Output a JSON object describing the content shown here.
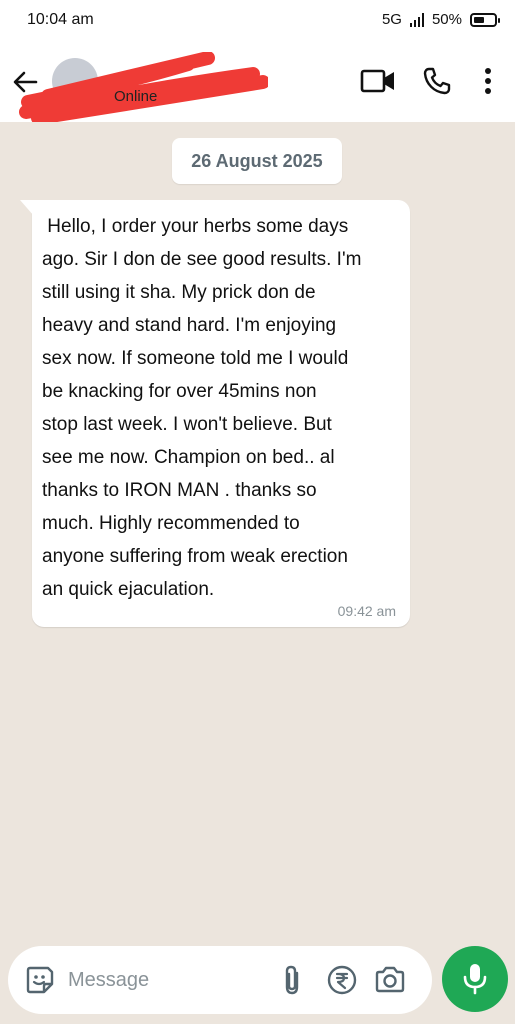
{
  "status_bar": {
    "time": "10:04 am",
    "network": "5G",
    "battery": "50%",
    "battery_level": 0.5
  },
  "header": {
    "contact_name": "",
    "contact_status": "Online",
    "icons": [
      "back-arrow-icon",
      "video-call-icon",
      "phone-icon",
      "more-vertical-icon"
    ]
  },
  "chat": {
    "date_label": "26 August 2025",
    "messages": [
      {
        "direction": "incoming",
        "lines": [
          " Hello, I order your herbs some days",
          "ago. Sir I don de see good results. I'm",
          "still using it sha. My prick don de",
          "heavy and stand hard. I'm enjoying",
          "sex now. If someone told me I would",
          "be knacking for over 45mins non",
          "stop last week. I won't believe. But",
          "see me now. Champion on bed.. al",
          "thanks to IRON MAN . thanks so",
          "much. Highly recommended to",
          "anyone suffering from weak erection",
          "an quick ejaculation."
        ],
        "time": "09:42 am"
      }
    ]
  },
  "composer": {
    "placeholder": "Message",
    "icons": [
      "sticker-icon",
      "attach-icon",
      "rupee-payment-icon",
      "camera-icon",
      "mic-icon"
    ]
  },
  "colors": {
    "chat_background": "#ece5dd",
    "bubble": "#ffffff",
    "accent_green": "#1fa855",
    "redaction": "#ef3b36"
  }
}
